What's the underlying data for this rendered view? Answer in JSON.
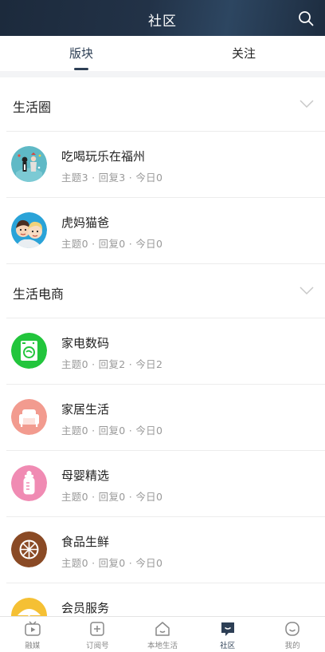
{
  "header": {
    "title": "社区",
    "search_icon": "search-icon"
  },
  "tabs": [
    {
      "label": "版块",
      "active": true
    },
    {
      "label": "关注",
      "active": false
    }
  ],
  "sections": [
    {
      "title": "生活圈",
      "items": [
        {
          "title": "吃喝玩乐在福州",
          "meta": "主题3 · 回复3 · 今日0",
          "icon": "illustration-icon"
        },
        {
          "title": "虎妈猫爸",
          "meta": "主题0 · 回复0 · 今日0",
          "icon": "parents-avatar-icon"
        }
      ]
    },
    {
      "title": "生活电商",
      "items": [
        {
          "title": "家电数码",
          "meta": "主题0 · 回复2 · 今日2",
          "icon": "washing-machine-icon",
          "color": "#22c53c"
        },
        {
          "title": "家居生活",
          "meta": "主题0 · 回复0 · 今日0",
          "icon": "sofa-icon",
          "color": "#f29b8f"
        },
        {
          "title": "母婴精选",
          "meta": "主题0 · 回复0 · 今日0",
          "icon": "baby-bottle-icon",
          "color": "#f08bb3"
        },
        {
          "title": "食品生鲜",
          "meta": "主题0 · 回复0 · 今日0",
          "icon": "orange-slice-icon",
          "color": "#8a4a25"
        },
        {
          "title": "会员服务",
          "meta": "",
          "icon": "umbrella-icon",
          "color": "#f5c034"
        }
      ]
    }
  ],
  "bottom_nav": [
    {
      "label": "融媒",
      "icon": "tv-play-icon",
      "active": false
    },
    {
      "label": "订阅号",
      "icon": "add-subscription-icon",
      "active": false
    },
    {
      "label": "本地生活",
      "icon": "home-icon",
      "active": false
    },
    {
      "label": "社区",
      "icon": "community-chat-icon",
      "active": true
    },
    {
      "label": "我的",
      "icon": "smile-icon",
      "active": false
    }
  ]
}
